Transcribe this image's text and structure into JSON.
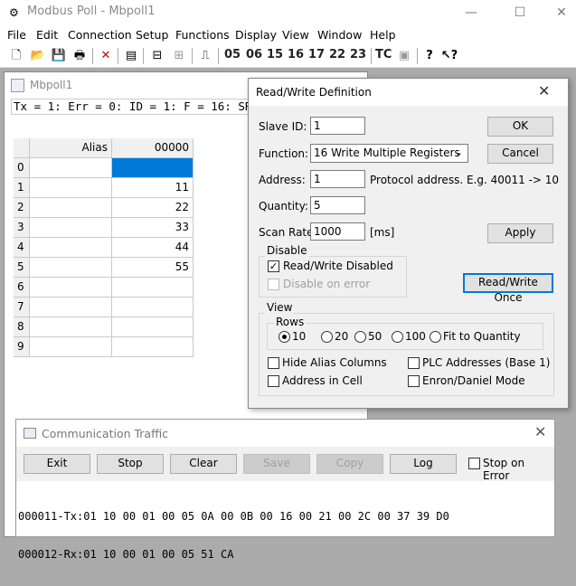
{
  "app": {
    "title": "Modbus Poll - Mbpoll1",
    "controls": {
      "minimize": "—",
      "maximize": "☐",
      "close": "✕"
    }
  },
  "menu": [
    "File",
    "Edit",
    "Connection",
    "Setup",
    "Functions",
    "Display",
    "View",
    "Window",
    "Help"
  ],
  "toolbar": {
    "function_codes": [
      "05",
      "06",
      "15",
      "16",
      "17",
      "22",
      "23"
    ],
    "tc_label": "TC"
  },
  "mdi": {
    "title": "Mbpoll1",
    "status": "Tx = 1: Err = 0: ID = 1: F = 16: SR = 1000",
    "grid": {
      "alias_header": "Alias",
      "col_header": "00000",
      "rows": [
        {
          "n": "0",
          "v": ""
        },
        {
          "n": "1",
          "v": "11"
        },
        {
          "n": "2",
          "v": "22"
        },
        {
          "n": "3",
          "v": "33"
        },
        {
          "n": "4",
          "v": "44"
        },
        {
          "n": "5",
          "v": "55"
        },
        {
          "n": "6",
          "v": ""
        },
        {
          "n": "7",
          "v": ""
        },
        {
          "n": "8",
          "v": ""
        },
        {
          "n": "9",
          "v": ""
        }
      ]
    }
  },
  "dialog": {
    "title": "Read/Write Definition",
    "slave_id_label": "Slave ID:",
    "slave_id": "1",
    "function_label": "Function:",
    "function_value": "16 Write Multiple Registers",
    "address_label": "Address:",
    "address": "1",
    "address_hint": "Protocol address. E.g. 40011 -> 10",
    "quantity_label": "Quantity:",
    "quantity": "5",
    "scan_rate_label": "Scan Rate:",
    "scan_rate": "1000",
    "scan_unit": "[ms]",
    "ok": "OK",
    "cancel": "Cancel",
    "apply": "Apply",
    "rw_once": "Read/Write Once",
    "disable_group": "Disable",
    "rw_disabled": "Read/Write Disabled",
    "disable_on_error": "Disable on error",
    "view_group": "View",
    "rows_group": "Rows",
    "rows_options": [
      "10",
      "20",
      "50",
      "100",
      "Fit to Quantity"
    ],
    "hide_alias": "Hide Alias Columns",
    "address_in_cell": "Address in Cell",
    "plc_addresses": "PLC Addresses (Base 1)",
    "enron": "Enron/Daniel Mode"
  },
  "comm": {
    "title": "Communication Traffic",
    "buttons": [
      "Exit",
      "Stop",
      "Clear",
      "Save",
      "Copy",
      "Log"
    ],
    "stop_on_error": "Stop on Error",
    "log": [
      "000011-Tx:01 10 00 01 00 05 0A 00 0B 00 16 00 21 00 2C 00 37 39 D0",
      "000012-Rx:01 10 00 01 00 05 51 CA"
    ]
  }
}
